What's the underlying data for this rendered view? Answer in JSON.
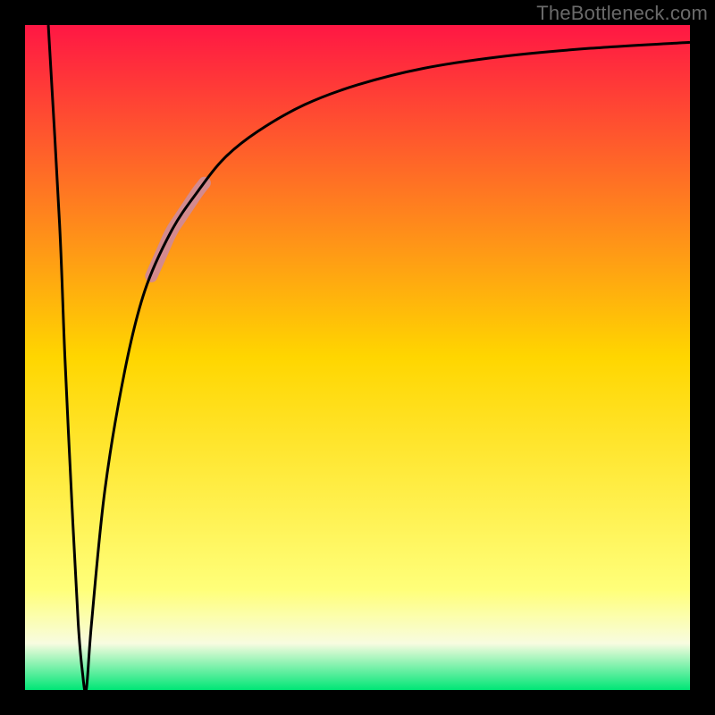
{
  "watermark": "TheBottleneck.com",
  "chart_data": {
    "type": "line",
    "title": "",
    "xlabel": "",
    "ylabel": "",
    "xlim": [
      0,
      100
    ],
    "ylim": [
      0,
      100
    ],
    "grid": false,
    "legend": false,
    "background_gradient": {
      "stops": [
        {
          "y": 0,
          "color": "#ff1744"
        },
        {
          "y": 50,
          "color": "#ffd600"
        },
        {
          "y": 85,
          "color": "#ffff7a"
        },
        {
          "y": 93,
          "color": "#f8fce0"
        },
        {
          "y": 100,
          "color": "#00e676"
        }
      ]
    },
    "series": [
      {
        "name": "bottleneck-curve-left",
        "x": [
          3.5,
          5.2,
          6.0,
          7.2,
          8.0,
          8.6,
          9.2
        ],
        "y": [
          100,
          70,
          50,
          25,
          10,
          3,
          0
        ],
        "note": "y is bottleneck percentage; plotted downward then inverted"
      },
      {
        "name": "bottleneck-curve-right",
        "x": [
          9.2,
          10,
          12,
          15,
          18,
          22,
          26,
          30,
          35,
          42,
          50,
          60,
          72,
          85,
          100
        ],
        "y": [
          0,
          10,
          30,
          48,
          60,
          69,
          75,
          80,
          84,
          88,
          91,
          93.5,
          95.3,
          96.5,
          97.4
        ]
      }
    ],
    "highlight_segment": {
      "x_range": [
        19,
        27
      ],
      "color": "#d38a8e",
      "stroke_width": 14
    },
    "frame": {
      "color": "#000000",
      "stroke_width": 28
    },
    "curve_style": {
      "color": "#000000",
      "stroke_width": 3
    }
  }
}
